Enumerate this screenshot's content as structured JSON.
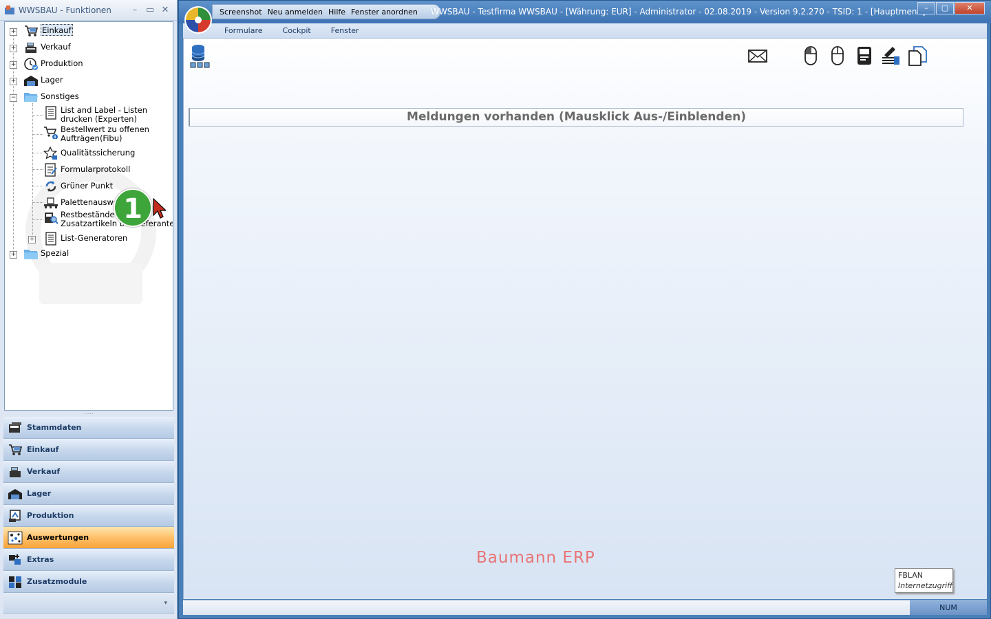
{
  "left_window": {
    "title": "WWSBAU - Funktionen",
    "minimize": "–",
    "restore": "▭",
    "close": "✕"
  },
  "tree": {
    "einkauf": "Einkauf",
    "verkauf": "Verkauf",
    "produktion": "Produktion",
    "lager": "Lager",
    "sonstiges": "Sonstiges",
    "list_label_1": "List and Label - Listen",
    "list_label_2": "drucken (Experten)",
    "bestellwert_1": "Bestellwert zu offenen",
    "bestellwert_2": "Aufträgen(Fibu)",
    "qualitaet": "Qualitätssicherung",
    "formularprotokoll": "Formularprotokoll",
    "gruener_punkt": "Grüner Punkt",
    "paletten": "Palettenauswertu",
    "restbestaende_1": "Restbestände von",
    "restbestaende_2": "Zusatzartikeln bei Lieferanten",
    "list_generatoren": "List-Generatoren",
    "spezial": "Spezial",
    "plus": "+",
    "minus": "−"
  },
  "callout": "1",
  "splitter": ".....",
  "nav": {
    "stammdaten": "Stammdaten",
    "einkauf": "Einkauf",
    "verkauf": "Verkauf",
    "lager": "Lager",
    "produktion": "Produktion",
    "auswertungen": "Auswertungen",
    "extras": "Extras",
    "zusatzmodule": "Zusatzmodule",
    "footer_arrow": "▾"
  },
  "main_window": {
    "quick_toolbar": {
      "screenshot": "Screenshot",
      "neu_anmelden": "Neu anmelden",
      "hilfe": "Hilfe",
      "fenster_anordnen": "Fenster anordnen",
      "dropdown": "▿"
    },
    "caption": "WWSBAU - Testfirma WWSBAU - [Währung: EUR] - Administrator - 02.08.2019 - Version 9.2.270 - TSID: 1  - [Hauptmenü]",
    "minimize": "–",
    "maximize": "▢",
    "close": "✕",
    "menu": {
      "formulare": "Formulare",
      "cockpit": "Cockpit",
      "fenster": "Fenster"
    },
    "message_bar": "Meldungen vorhanden  (Mausklick Aus-/Einblenden)",
    "brand": "Baumann ERP",
    "tooltip_title": "FBLAN",
    "tooltip_sub": "Internetzugriff",
    "status_num": "NUM"
  },
  "colors": {
    "active_nav": "#f7a33a",
    "brand": "#e87474",
    "callout": "#3ea53a"
  }
}
